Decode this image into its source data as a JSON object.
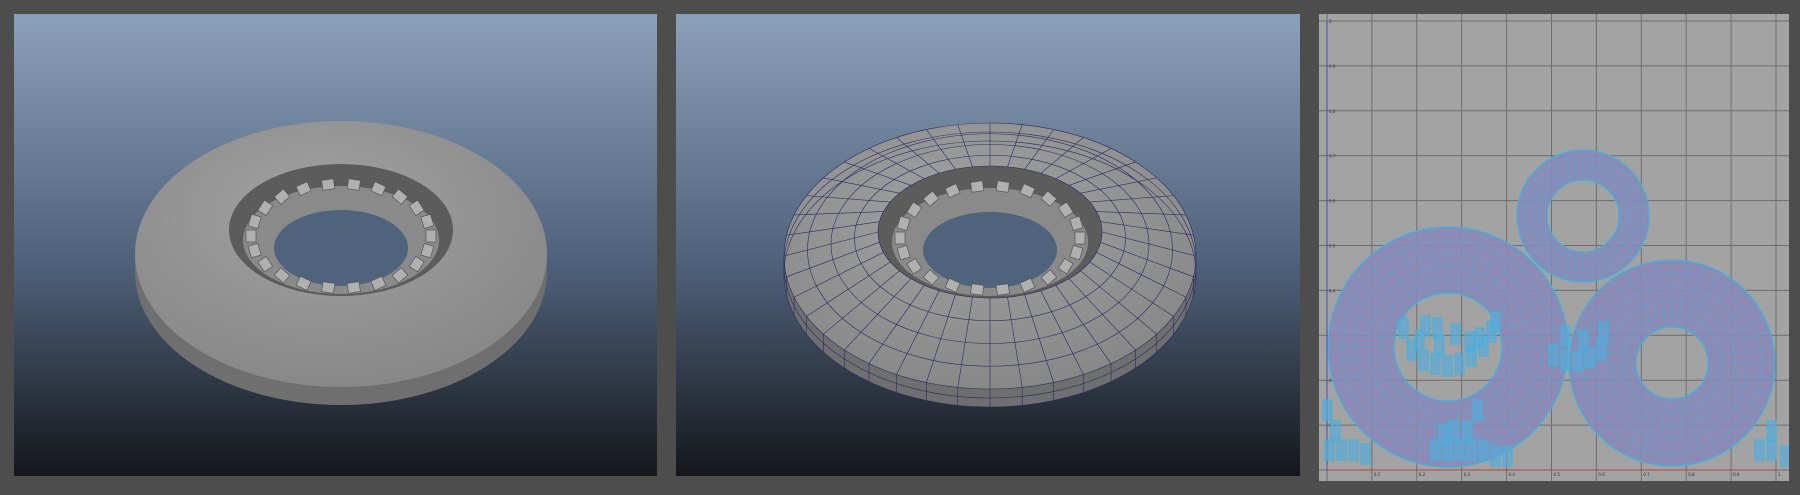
{
  "viewports": [
    {
      "name": "shaded-viewport"
    },
    {
      "name": "wireframe-viewport"
    },
    {
      "name": "uv-editor"
    }
  ],
  "colors": {
    "bg_top": "#8ba0ba",
    "bg_bottom": "#15171b",
    "mesh": "#9a9a9a",
    "wire": "#2a2a66",
    "uv_fill": "#8a88b8",
    "uv_edge": "#3fb3df",
    "grid": "#6e6e6e"
  },
  "uv_editor": {
    "u_ticks": [
      "0",
      "0.1",
      "0.2",
      "0.3",
      "0.4",
      "0.5",
      "0.6",
      "0.7",
      "0.8",
      "0.9",
      "1"
    ],
    "v_ticks": [
      "0",
      "0.1",
      "0.2",
      "0.3",
      "0.4",
      "0.5",
      "0.6",
      "0.7",
      "0.8",
      "0.9",
      "1"
    ]
  }
}
